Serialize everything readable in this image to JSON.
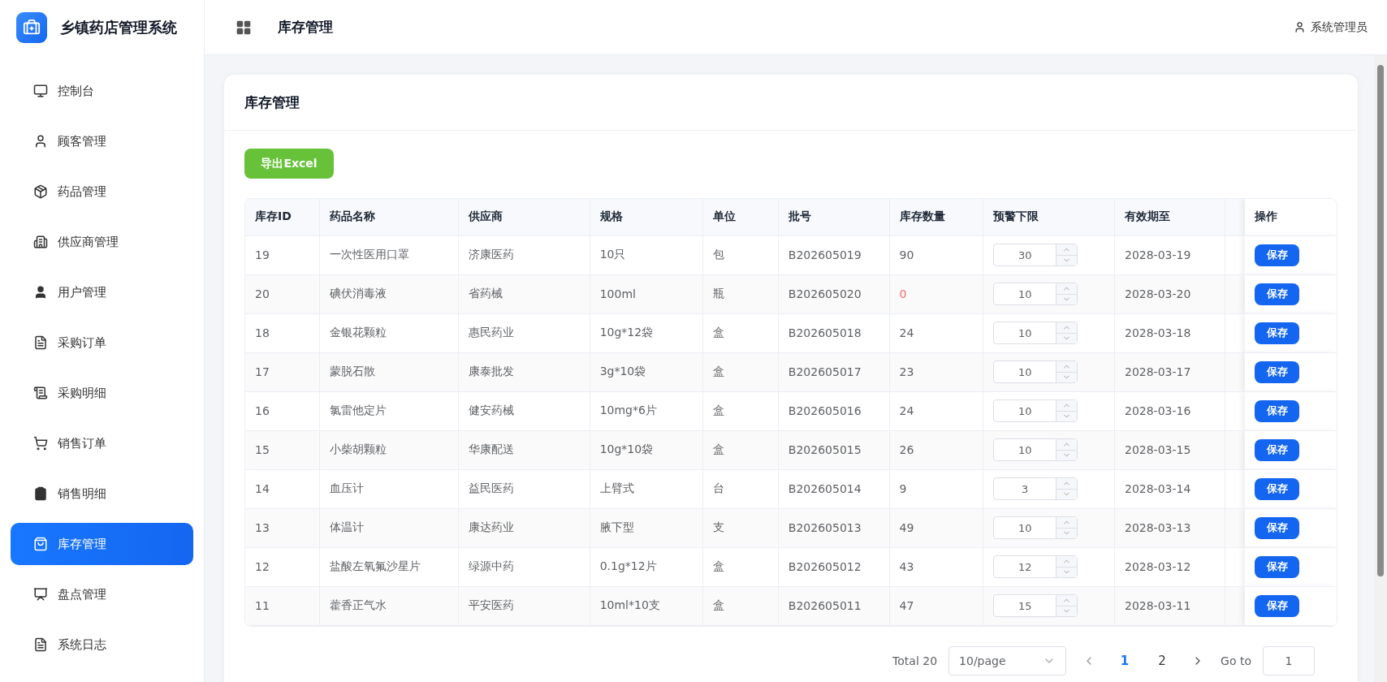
{
  "app": {
    "title": "乡镇药店管理系统"
  },
  "sidebar": {
    "items": [
      {
        "label": "控制台",
        "selected": false
      },
      {
        "label": "顾客管理",
        "selected": false
      },
      {
        "label": "药品管理",
        "selected": false
      },
      {
        "label": "供应商管理",
        "selected": false
      },
      {
        "label": "用户管理",
        "selected": false
      },
      {
        "label": "采购订单",
        "selected": false
      },
      {
        "label": "采购明细",
        "selected": false
      },
      {
        "label": "销售订单",
        "selected": false
      },
      {
        "label": "销售明细",
        "selected": false
      },
      {
        "label": "库存管理",
        "selected": true
      },
      {
        "label": "盘点管理",
        "selected": false
      },
      {
        "label": "系统日志",
        "selected": false
      }
    ]
  },
  "header": {
    "title": "库存管理",
    "user": "系统管理员"
  },
  "card": {
    "title": "库存管理",
    "export_button": "导出Excel"
  },
  "table": {
    "columns": [
      "库存ID",
      "药品名称",
      "供应商",
      "规格",
      "单位",
      "批号",
      "库存数量",
      "预警下限",
      "有效期至",
      "操作"
    ],
    "rows": [
      {
        "id": "19",
        "name": "一次性医用口罩",
        "supplier": "济康医药",
        "spec": "10只",
        "unit": "包",
        "batch": "B202605019",
        "quantity": "90",
        "low": false,
        "threshold": "30",
        "expiry": "2028-03-19",
        "action": "保存"
      },
      {
        "id": "20",
        "name": "碘伏消毒液",
        "supplier": "省药械",
        "spec": "100ml",
        "unit": "瓶",
        "batch": "B202605020",
        "quantity": "0",
        "low": true,
        "threshold": "10",
        "expiry": "2028-03-20",
        "action": "保存"
      },
      {
        "id": "18",
        "name": "金银花颗粒",
        "supplier": "惠民药业",
        "spec": "10g*12袋",
        "unit": "盒",
        "batch": "B202605018",
        "quantity": "24",
        "low": false,
        "threshold": "10",
        "expiry": "2028-03-18",
        "action": "保存"
      },
      {
        "id": "17",
        "name": "蒙脱石散",
        "supplier": "康泰批发",
        "spec": "3g*10袋",
        "unit": "盒",
        "batch": "B202605017",
        "quantity": "23",
        "low": false,
        "threshold": "10",
        "expiry": "2028-03-17",
        "action": "保存"
      },
      {
        "id": "16",
        "name": "氯雷他定片",
        "supplier": "健安药械",
        "spec": "10mg*6片",
        "unit": "盒",
        "batch": "B202605016",
        "quantity": "24",
        "low": false,
        "threshold": "10",
        "expiry": "2028-03-16",
        "action": "保存"
      },
      {
        "id": "15",
        "name": "小柴胡颗粒",
        "supplier": "华康配送",
        "spec": "10g*10袋",
        "unit": "盒",
        "batch": "B202605015",
        "quantity": "26",
        "low": false,
        "threshold": "10",
        "expiry": "2028-03-15",
        "action": "保存"
      },
      {
        "id": "14",
        "name": "血压计",
        "supplier": "益民医药",
        "spec": "上臂式",
        "unit": "台",
        "batch": "B202605014",
        "quantity": "9",
        "low": false,
        "threshold": "3",
        "expiry": "2028-03-14",
        "action": "保存"
      },
      {
        "id": "13",
        "name": "体温计",
        "supplier": "康达药业",
        "spec": "腋下型",
        "unit": "支",
        "batch": "B202605013",
        "quantity": "49",
        "low": false,
        "threshold": "10",
        "expiry": "2028-03-13",
        "action": "保存"
      },
      {
        "id": "12",
        "name": "盐酸左氧氟沙星片",
        "supplier": "绿源中药",
        "spec": "0.1g*12片",
        "unit": "盒",
        "batch": "B202605012",
        "quantity": "43",
        "low": false,
        "threshold": "12",
        "expiry": "2028-03-12",
        "action": "保存"
      },
      {
        "id": "11",
        "name": "藿香正气水",
        "supplier": "平安医药",
        "spec": "10ml*10支",
        "unit": "盒",
        "batch": "B202605011",
        "quantity": "47",
        "low": false,
        "threshold": "15",
        "expiry": "2028-03-11",
        "action": "保存"
      }
    ]
  },
  "pagination": {
    "total": "Total 20",
    "page_size": "10/page",
    "pages": [
      {
        "label": "1",
        "selected": true
      },
      {
        "label": "2",
        "selected": false
      }
    ],
    "goto_label": "Go to",
    "goto_value": "1"
  }
}
